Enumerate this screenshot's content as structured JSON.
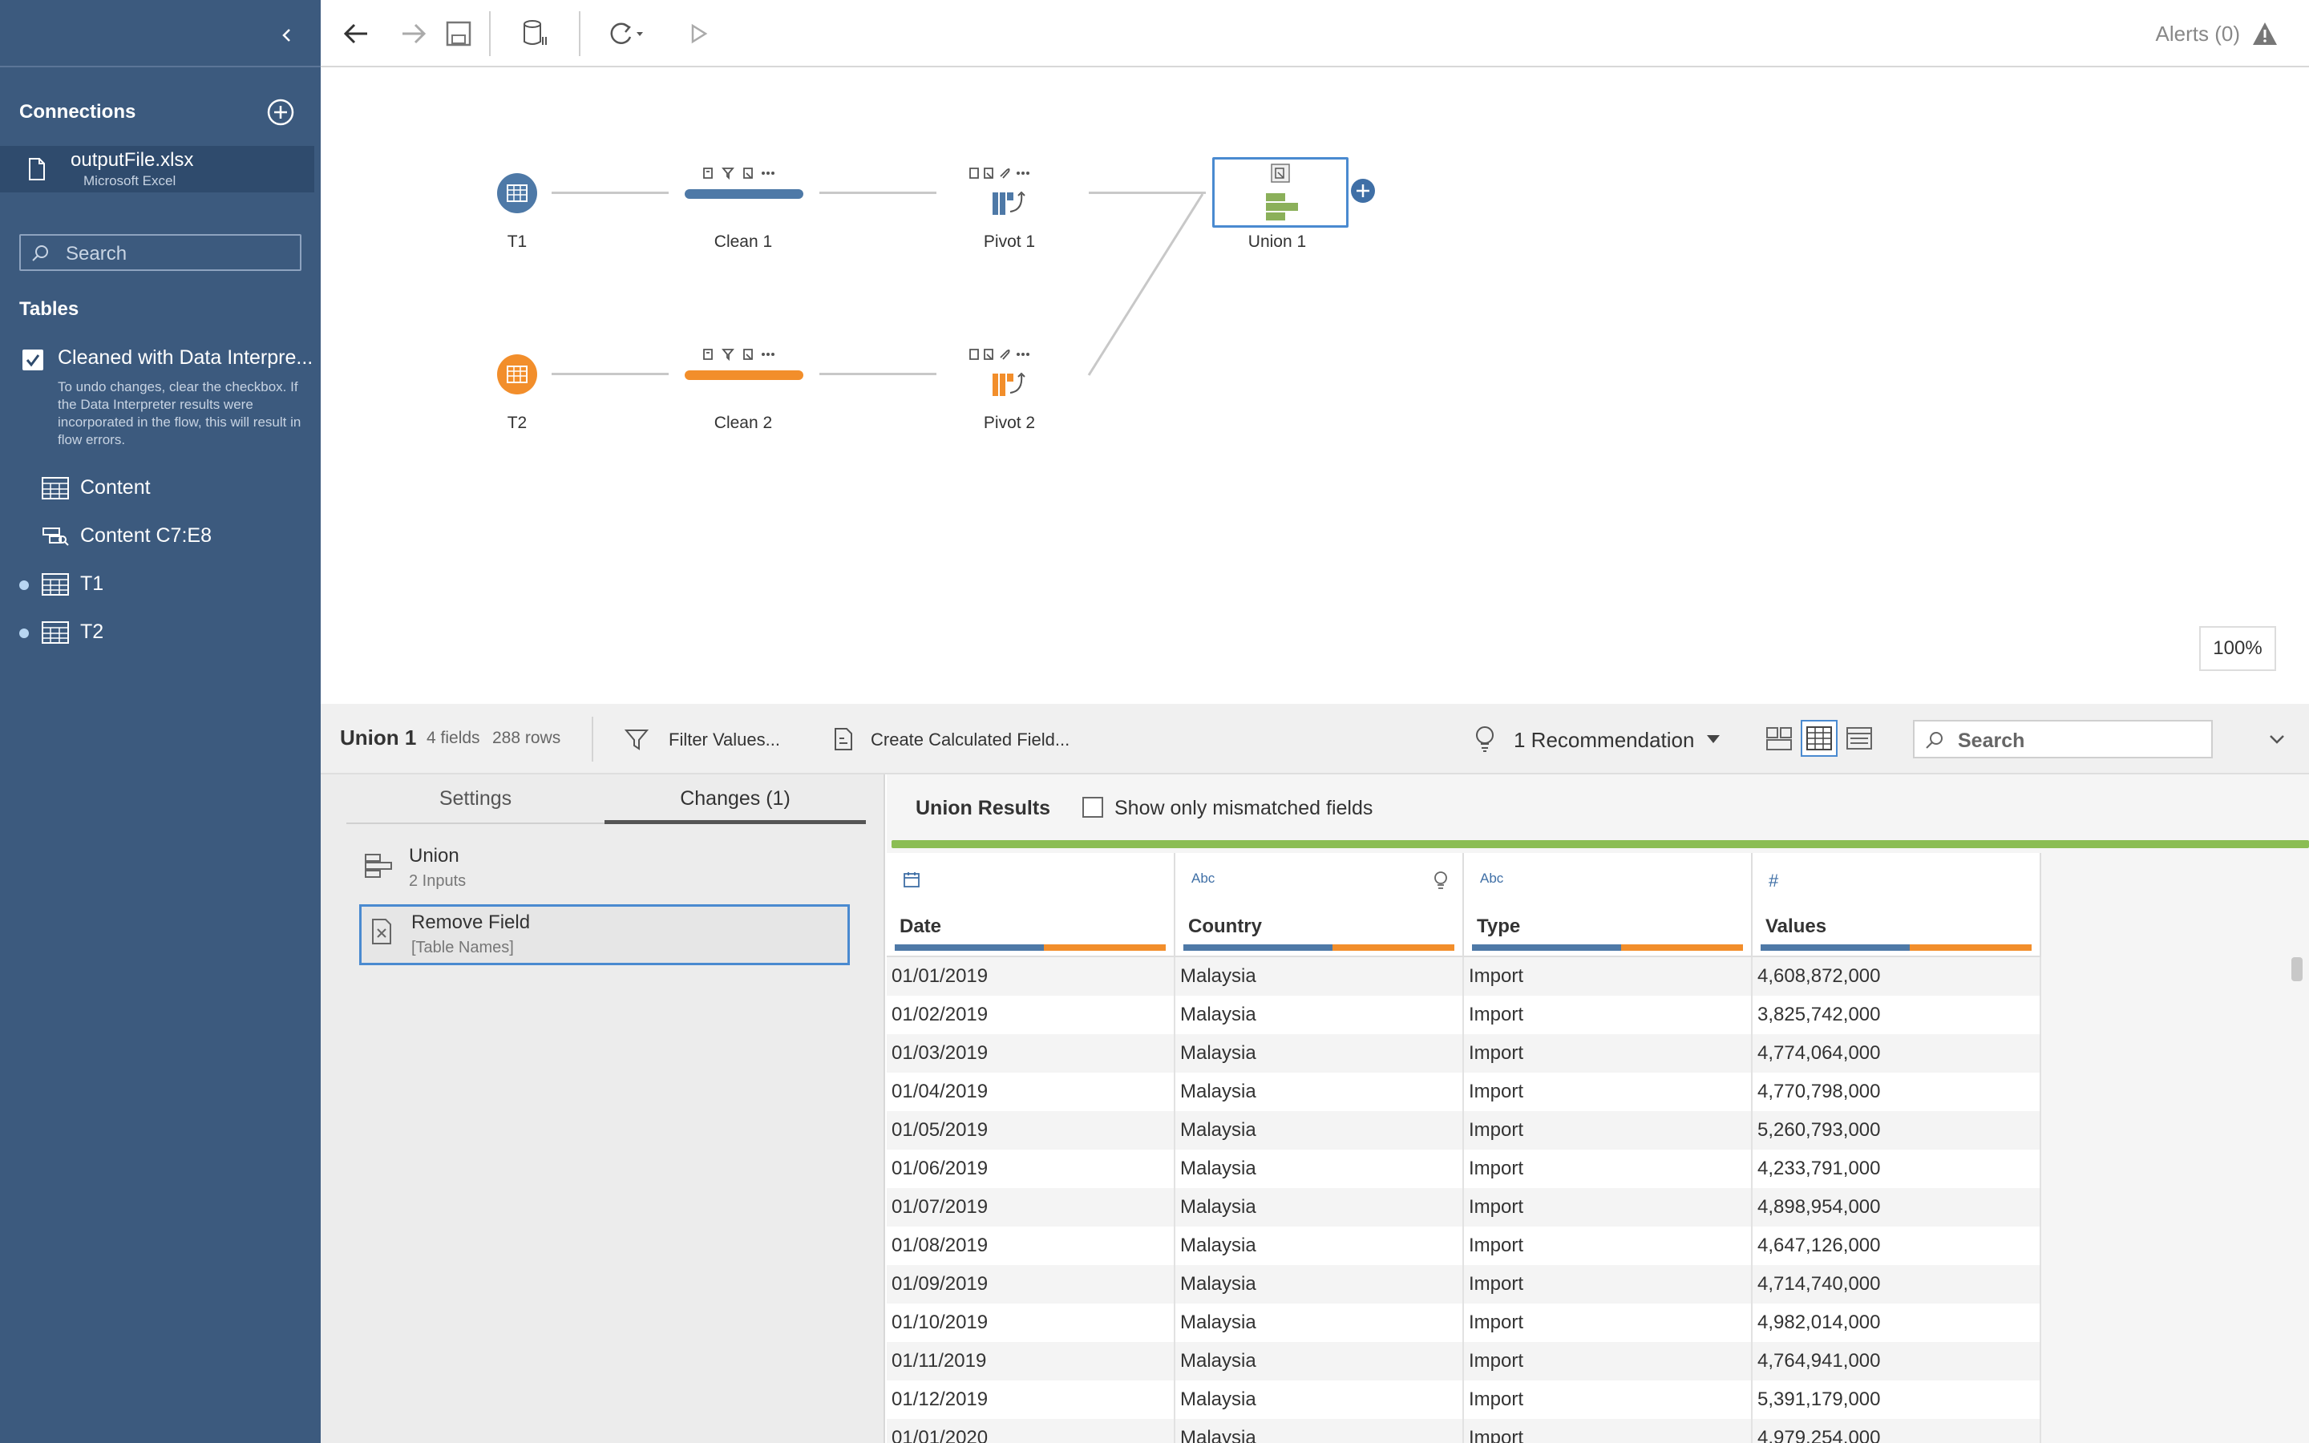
{
  "sidebar": {
    "connections_title": "Connections",
    "connection": {
      "name": "outputFile.xlsx",
      "type": "Microsoft Excel"
    },
    "search_placeholder": "Search",
    "tables_title": "Tables",
    "data_interpreter": {
      "label": "Cleaned with Data Interpre...",
      "checked": true,
      "note": "To undo changes, clear the checkbox. If the Data Interpreter results were incorporated in the flow, this will result in flow errors."
    },
    "tables": [
      {
        "label": "Content",
        "icon": "table-icon",
        "in_flow": false
      },
      {
        "label": "Content C7:E8",
        "icon": "named-range-icon",
        "in_flow": false
      },
      {
        "label": "T1",
        "icon": "table-icon",
        "in_flow": true
      },
      {
        "label": "T2",
        "icon": "table-icon",
        "in_flow": true
      }
    ]
  },
  "toolbar": {
    "buttons": [
      "back-icon",
      "forward-icon",
      "save-icon",
      "data-source-icon",
      "refresh-icon",
      "run-icon"
    ],
    "alerts_label": "Alerts (0)"
  },
  "flow": {
    "nodes": [
      {
        "label": "T1",
        "kind": "input",
        "color": "#4e79a7"
      },
      {
        "label": "Clean 1",
        "kind": "clean",
        "color": "#4e79a7"
      },
      {
        "label": "Pivot 1",
        "kind": "pivot",
        "color": "#4e79a7"
      },
      {
        "label": "Union 1",
        "kind": "union",
        "color": "#8bb05a",
        "selected": true
      },
      {
        "label": "T2",
        "kind": "input",
        "color": "#f28e2b"
      },
      {
        "label": "Clean 2",
        "kind": "clean",
        "color": "#f28e2b"
      },
      {
        "label": "Pivot 2",
        "kind": "pivot",
        "color": "#f28e2b"
      }
    ],
    "zoom": "100%"
  },
  "bottom_header": {
    "step_name": "Union 1",
    "fields": "4 fields",
    "rows": "288 rows",
    "filter_label": "Filter Values...",
    "calc_label": "Create Calculated Field...",
    "recommendation_label": "1 Recommendation",
    "search_placeholder": "Search"
  },
  "left_panel": {
    "tabs": [
      "Settings",
      "Changes (1)"
    ],
    "active_tab": "Changes (1)",
    "changes": [
      {
        "title": "Union",
        "subtitle": "2 Inputs",
        "icon": "union-icon"
      },
      {
        "title": "Remove Field",
        "subtitle": "[Table Names]",
        "icon": "remove-field-icon",
        "selected": true
      }
    ]
  },
  "results": {
    "title": "Union Results",
    "mismatch_label": "Show only mismatched fields",
    "mismatch_checked": false,
    "columns": [
      {
        "name": "Date",
        "type": "calendar-icon"
      },
      {
        "name": "Country",
        "type": "Abc"
      },
      {
        "name": "Type",
        "type": "Abc"
      },
      {
        "name": "Values",
        "type": "#"
      }
    ],
    "rows": [
      [
        "01/01/2019",
        "Malaysia",
        "Import",
        "4,608,872,000"
      ],
      [
        "01/02/2019",
        "Malaysia",
        "Import",
        "3,825,742,000"
      ],
      [
        "01/03/2019",
        "Malaysia",
        "Import",
        "4,774,064,000"
      ],
      [
        "01/04/2019",
        "Malaysia",
        "Import",
        "4,770,798,000"
      ],
      [
        "01/05/2019",
        "Malaysia",
        "Import",
        "5,260,793,000"
      ],
      [
        "01/06/2019",
        "Malaysia",
        "Import",
        "4,233,791,000"
      ],
      [
        "01/07/2019",
        "Malaysia",
        "Import",
        "4,898,954,000"
      ],
      [
        "01/08/2019",
        "Malaysia",
        "Import",
        "4,647,126,000"
      ],
      [
        "01/09/2019",
        "Malaysia",
        "Import",
        "4,714,740,000"
      ],
      [
        "01/10/2019",
        "Malaysia",
        "Import",
        "4,982,014,000"
      ],
      [
        "01/11/2019",
        "Malaysia",
        "Import",
        "4,764,941,000"
      ],
      [
        "01/12/2019",
        "Malaysia",
        "Import",
        "5,391,179,000"
      ],
      [
        "01/01/2020",
        "Malaysia",
        "Import",
        "4,979,254,000"
      ]
    ]
  },
  "colors": {
    "sidebar_bg": "#3c5a7e",
    "series_blue": "#4e79a7",
    "series_orange": "#f28e2b",
    "union_green": "#8bbd54",
    "selection_blue": "#4a8ad0"
  }
}
